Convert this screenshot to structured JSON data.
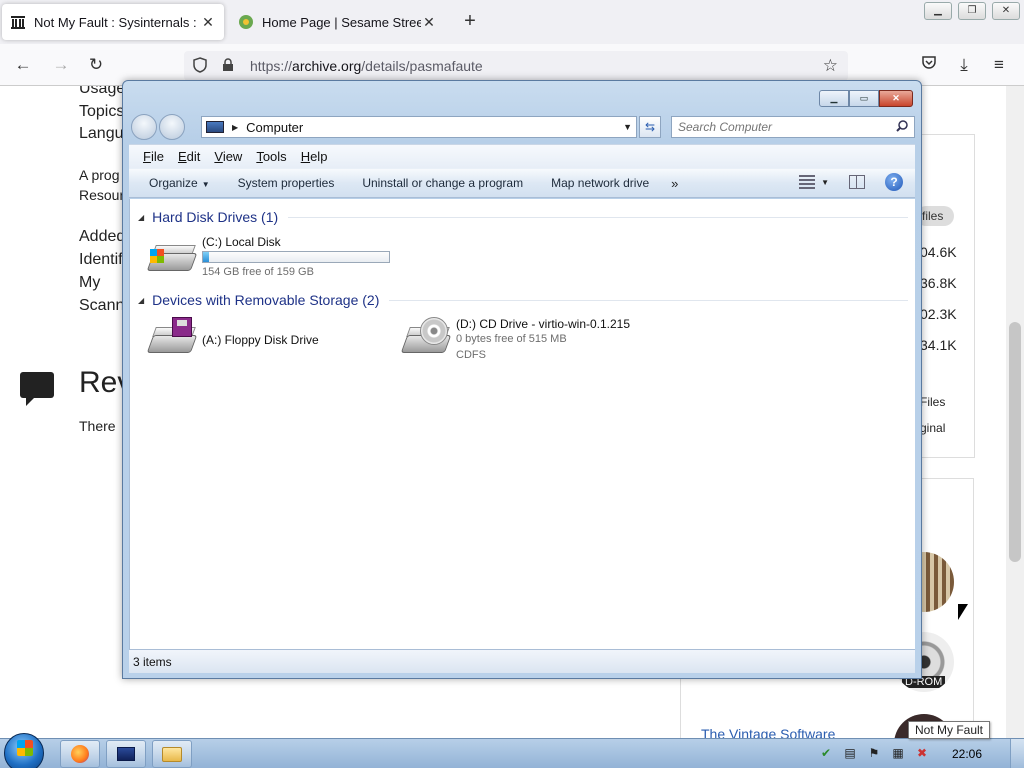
{
  "browser": {
    "tabs": [
      {
        "title": "Not My Fault : Sysinternals : Fre"
      },
      {
        "title": "Home Page | Sesame Street | PB"
      }
    ],
    "url_prefix": "https://",
    "url_domain": "archive.org",
    "url_path": "/details/pasmafaute"
  },
  "webpage": {
    "meta_labels": [
      "Usage",
      "Topics",
      "Langu"
    ],
    "desc": [
      "A prog",
      "Resour"
    ],
    "meta_labels2": [
      "Added",
      "Identifi",
      "My",
      "Scann"
    ],
    "reviews_heading": "Rev",
    "reviews_text": "There",
    "right_sizes": [
      "04.6K",
      "36.8K",
      "02.3K",
      "34.1K"
    ],
    "files_pill": "files",
    "right_links": [
      "Files",
      "ginal"
    ],
    "cdrom_label": "D-ROM",
    "vintage_link": "The Vintage Software"
  },
  "explorer": {
    "address": "Computer",
    "search_placeholder": "Search Computer",
    "menu": [
      {
        "label": "File",
        "key": "F",
        "rest": "ile"
      },
      {
        "label": "Edit",
        "key": "E",
        "rest": "dit"
      },
      {
        "label": "View",
        "key": "V",
        "rest": "iew"
      },
      {
        "label": "Tools",
        "key": "T",
        "rest": "ools"
      },
      {
        "label": "Help",
        "key": "H",
        "rest": "elp"
      }
    ],
    "toolbar": {
      "organize": "Organize",
      "system_properties": "System properties",
      "uninstall": "Uninstall or change a program",
      "map_drive": "Map network drive",
      "more": "»"
    },
    "groups": [
      {
        "title": "Hard Disk Drives (1)"
      },
      {
        "title": "Devices with Removable Storage (2)"
      }
    ],
    "drives": {
      "c": {
        "name": "(C:) Local Disk",
        "free": "154 GB free of 159 GB",
        "used_fraction": 0.031
      },
      "a": {
        "name": "(A:) Floppy Disk Drive"
      },
      "d": {
        "name": "(D:) CD Drive - virtio-win-0.1.215",
        "free": "0 bytes free of 515 MB",
        "fs": "CDFS"
      }
    },
    "status": "3 items"
  },
  "taskbar": {
    "clock": "22:06",
    "tooltip": "Not My Fault"
  },
  "colors": {
    "group_title": "#1e3287",
    "capacity_fill": "#2a8fd7",
    "link": "#2a5db0"
  },
  "icons": [
    "archive-favicon",
    "sesame-favicon",
    "back-arrow-icon",
    "forward-arrow-icon",
    "reload-icon",
    "shield-icon",
    "lock-icon",
    "star-icon",
    "pocket-icon",
    "download-icon",
    "menu-icon",
    "search-icon",
    "help-icon",
    "hard-disk-icon",
    "floppy-icon",
    "cd-drive-icon",
    "windows-start-icon",
    "firefox-icon",
    "folder-icon"
  ]
}
